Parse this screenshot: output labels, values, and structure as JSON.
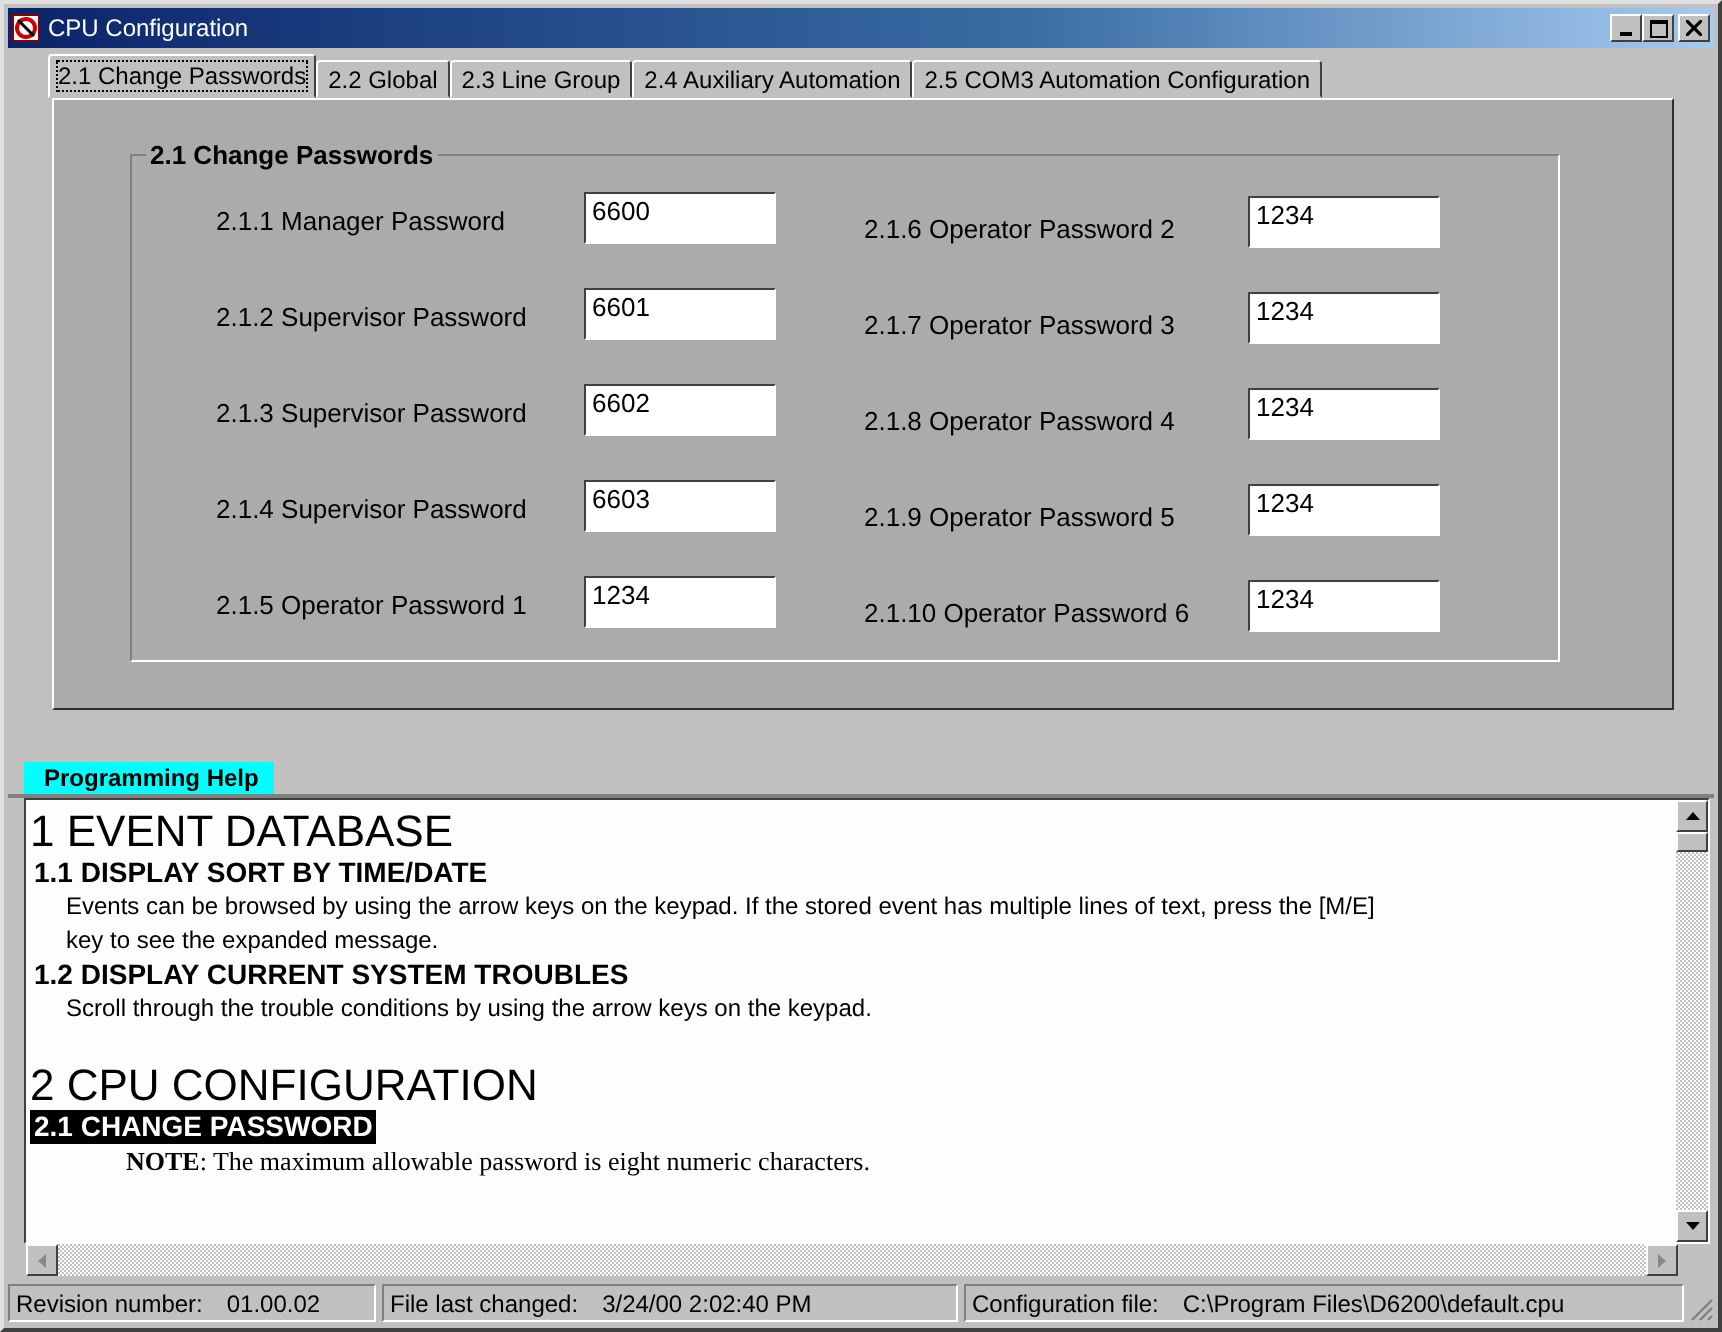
{
  "window": {
    "title": "CPU Configuration"
  },
  "tabs": [
    {
      "label": "2.1 Change Passwords",
      "selected": true
    },
    {
      "label": "2.2 Global",
      "selected": false
    },
    {
      "label": "2.3 Line Group",
      "selected": false
    },
    {
      "label": "2.4 Auxiliary Automation",
      "selected": false
    },
    {
      "label": "2.5 COM3 Automation Configuration",
      "selected": false
    }
  ],
  "group": {
    "title": "2.1 Change Passwords",
    "columns": [
      [
        {
          "label": "2.1.1 Manager Password",
          "value": "6600"
        },
        {
          "label": "2.1.2 Supervisor Password",
          "value": "6601"
        },
        {
          "label": "2.1.3 Supervisor Password",
          "value": "6602"
        },
        {
          "label": "2.1.4 Supervisor Password",
          "value": "6603"
        },
        {
          "label": "2.1.5 Operator Password 1",
          "value": "1234"
        }
      ],
      [
        {
          "label": "2.1.6 Operator Password 2",
          "value": "1234"
        },
        {
          "label": "2.1.7 Operator Password 3",
          "value": "1234"
        },
        {
          "label": "2.1.8 Operator Password 4",
          "value": "1234"
        },
        {
          "label": "2.1.9 Operator Password 5",
          "value": "1234"
        },
        {
          "label": "2.1.10 Operator Password 6",
          "value": "1234"
        }
      ]
    ]
  },
  "help": {
    "title": "Programming Help",
    "blocks": [
      {
        "kind": "h1",
        "text": "1 EVENT DATABASE"
      },
      {
        "kind": "h2",
        "text": "1.1  DISPLAY SORT BY TIME/DATE",
        "highlighted": false
      },
      {
        "kind": "body",
        "text": "Events can be browsed by using the arrow keys on the keypad. If the stored event has multiple lines of text, press the [M/E] key to see the expanded message."
      },
      {
        "kind": "h2",
        "text": "1.2  DISPLAY CURRENT SYSTEM TROUBLES",
        "highlighted": false
      },
      {
        "kind": "body",
        "text": "Scroll through the trouble conditions by using the arrow keys on the keypad."
      },
      {
        "kind": "h1",
        "text": "2 CPU CONFIGURATION"
      },
      {
        "kind": "h2",
        "text": "2.1  CHANGE PASSWORD",
        "highlighted": true
      },
      {
        "kind": "note",
        "text": "**NOTE**:  The maximum allowable password is eight numeric characters."
      }
    ]
  },
  "status_bar": [
    {
      "label": "Revision number:",
      "value": "01.00.02"
    },
    {
      "label": "File last changed:",
      "value": "3/24/00 2:02:40 PM"
    },
    {
      "label": "Configuration file:",
      "value": "C:\\Program Files\\D6200\\default.cpu"
    }
  ]
}
